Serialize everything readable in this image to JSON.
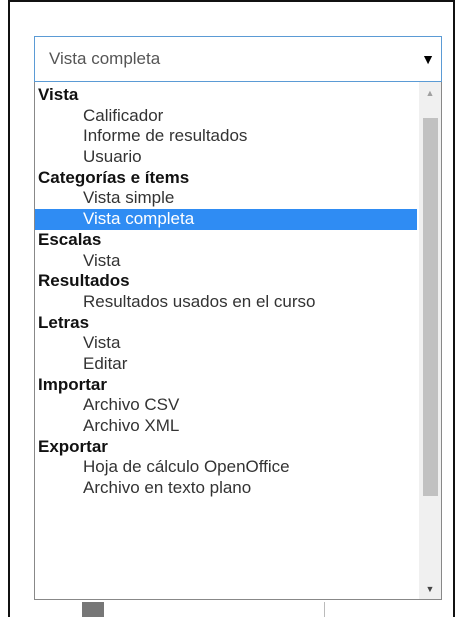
{
  "select": {
    "value": "Vista completa"
  },
  "options": [
    {
      "label": "Vista",
      "kind": "group"
    },
    {
      "label": "Calificador",
      "kind": "item"
    },
    {
      "label": "Informe de resultados",
      "kind": "item"
    },
    {
      "label": "Usuario",
      "kind": "item"
    },
    {
      "label": "Categorías e ítems",
      "kind": "group"
    },
    {
      "label": "Vista simple",
      "kind": "item"
    },
    {
      "label": "Vista completa",
      "kind": "item",
      "selected": true
    },
    {
      "label": "Escalas",
      "kind": "group"
    },
    {
      "label": "Vista",
      "kind": "item"
    },
    {
      "label": "Resultados",
      "kind": "group"
    },
    {
      "label": "Resultados usados en el curso",
      "kind": "item"
    },
    {
      "label": "Letras",
      "kind": "group"
    },
    {
      "label": "Vista",
      "kind": "item"
    },
    {
      "label": "Editar",
      "kind": "item"
    },
    {
      "label": "Importar",
      "kind": "group"
    },
    {
      "label": "Archivo CSV",
      "kind": "item"
    },
    {
      "label": "Archivo XML",
      "kind": "item"
    },
    {
      "label": "Exportar",
      "kind": "group"
    },
    {
      "label": "Hoja de cálculo OpenOffice",
      "kind": "item"
    },
    {
      "label": "Archivo en texto plano",
      "kind": "item"
    }
  ],
  "icons": {
    "dropdown_arrow": "▼",
    "scroll_up": "▲",
    "scroll_down": "▼"
  },
  "colors": {
    "selected_bg": "#2f8cf3",
    "focus_border": "#5b9bd5"
  }
}
